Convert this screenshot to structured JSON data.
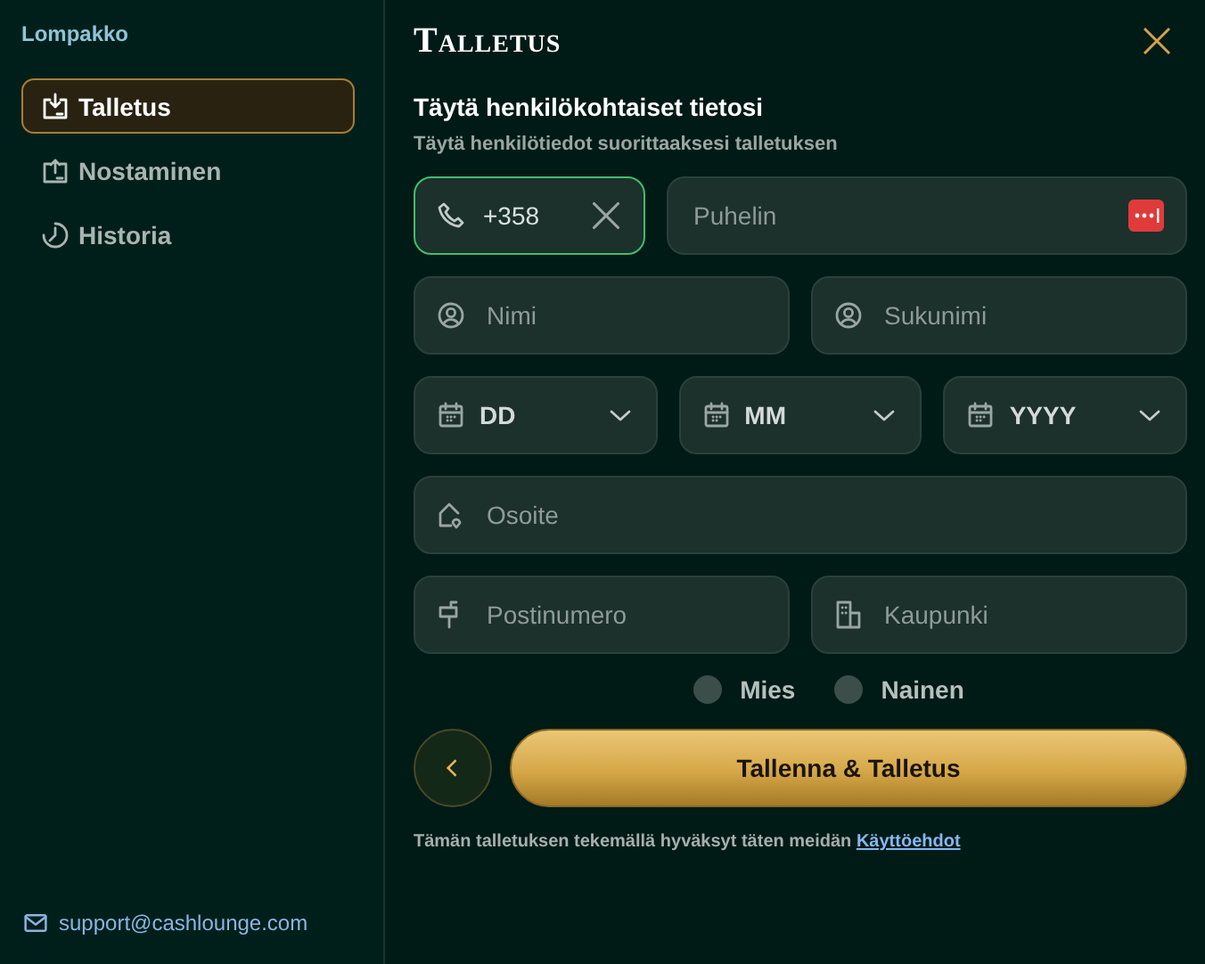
{
  "sidebar": {
    "title": "Lompakko",
    "items": [
      {
        "label": "Talletus",
        "selected": true
      },
      {
        "label": "Nostaminen",
        "selected": false
      },
      {
        "label": "Historia",
        "selected": false
      }
    ],
    "support_email": "support@cashlounge.com"
  },
  "dialog": {
    "title": "Talletus",
    "heading": "Täytä henkilökohtaiset tietosi",
    "subheading": "Täytä henkilötiedot suorittaaksesi talletuksen",
    "phone": {
      "country_code": "+358",
      "focused": true,
      "placeholder": "Puhelin"
    },
    "name_fields": [
      {
        "placeholder": "Nimi"
      },
      {
        "placeholder": "Sukunimi"
      }
    ],
    "date_selects": [
      {
        "label": "DD"
      },
      {
        "label": "MM"
      },
      {
        "label": "YYYY"
      }
    ],
    "address": {
      "placeholder": "Osoite"
    },
    "location_fields": [
      {
        "placeholder": "Postinumero"
      },
      {
        "placeholder": "Kaupunki"
      }
    ],
    "gender": [
      {
        "label": "Mies",
        "selected": false
      },
      {
        "label": "Nainen",
        "selected": false
      }
    ],
    "submit": "Tallenna & Talletus",
    "terms_text": "Tämän talletuksen tekemällä hyväksyt täten meidän",
    "terms_link": "Käyttöehdot"
  }
}
